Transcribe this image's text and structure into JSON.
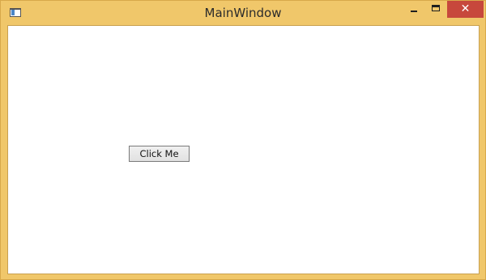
{
  "window": {
    "title": "MainWindow",
    "accent_color": "#f0c76a",
    "close_color": "#c7483c"
  },
  "titlebar_controls": {
    "minimize_icon": "minimize-icon",
    "maximize_icon": "maximize-icon",
    "close_icon": "close-icon",
    "close_glyph": "✕"
  },
  "app_icon": "window-app-icon",
  "main": {
    "button_label": "Click Me"
  }
}
